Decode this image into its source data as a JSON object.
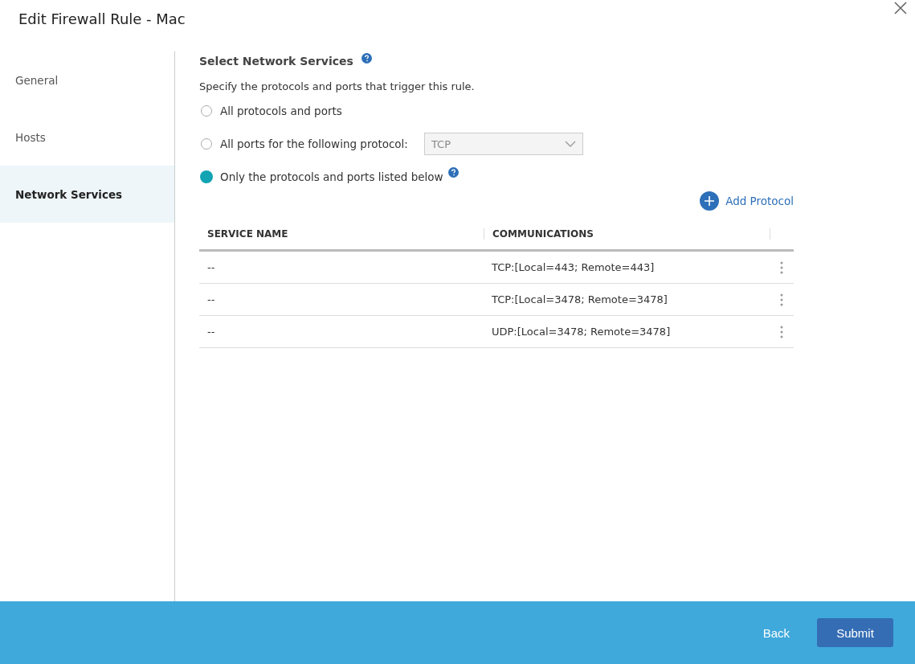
{
  "dialog": {
    "title": "Edit Firewall Rule - Mac"
  },
  "sidebar": {
    "items": [
      {
        "label": "General",
        "selected": false
      },
      {
        "label": "Hosts",
        "selected": false
      },
      {
        "label": "Network Services",
        "selected": true
      }
    ]
  },
  "section": {
    "title": "Select Network Services",
    "description": "Specify the protocols and ports that trigger this rule."
  },
  "options": [
    {
      "kind": "plain",
      "label": "All protocols and ports",
      "selected": false
    },
    {
      "kind": "dropdown",
      "label": "All ports for the following protocol:",
      "selected": false,
      "value": "TCP",
      "disabled": true
    },
    {
      "kind": "help",
      "label": "Only the protocols and ports listed below",
      "selected": true
    }
  ],
  "add_button": "Add Protocol",
  "table": {
    "columns": [
      "SERVICE NAME",
      "COMMUNICATIONS"
    ],
    "rows": [
      {
        "service_name": "--",
        "communications": "TCP:[Local=443; Remote=443]"
      },
      {
        "service_name": "--",
        "communications": "TCP:[Local=3478; Remote=3478]"
      },
      {
        "service_name": "--",
        "communications": "UDP:[Local=3478; Remote=3478]"
      }
    ]
  },
  "footer": {
    "buttons": [
      {
        "label": "Back",
        "kind": "link"
      },
      {
        "label": "Submit",
        "kind": "primary"
      }
    ]
  }
}
